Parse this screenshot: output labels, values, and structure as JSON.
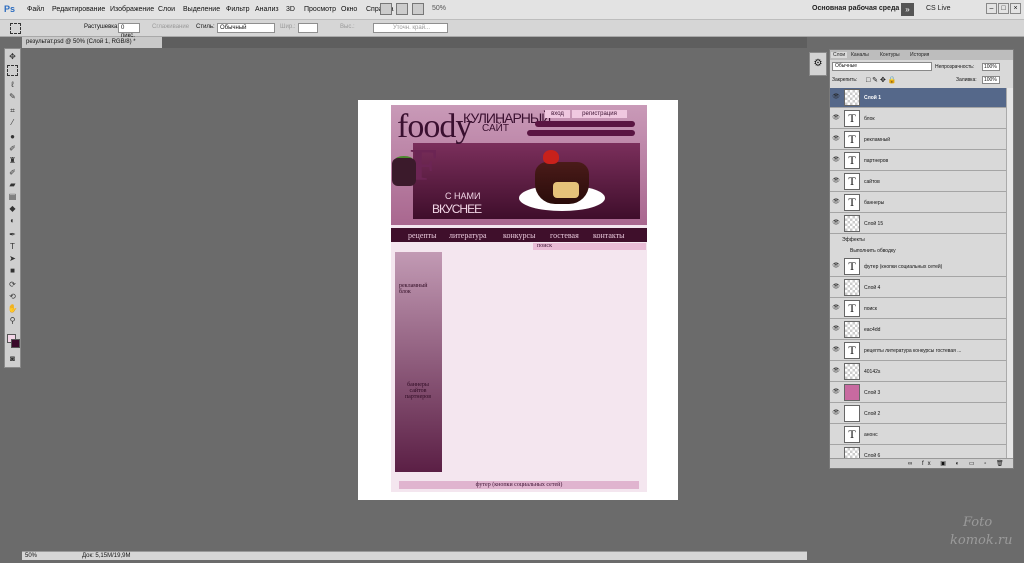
{
  "app": {
    "logo": "Ps"
  },
  "menu": [
    "Файл",
    "Редактирование",
    "Изображение",
    "Слои",
    "Выделение",
    "Фильтр",
    "Анализ",
    "3D",
    "Просмотр",
    "Окно",
    "Справка"
  ],
  "appbar": {
    "zoom": "50%",
    "workspace": "Основная рабочая среда",
    "cslive": "CS Live"
  },
  "options": {
    "feather_label": "Растушевка:",
    "feather_value": "0 пикс.",
    "antialias": "Сглаживание",
    "style_label": "Стиль:",
    "style_value": "Обычный",
    "width_label": "Шир.:",
    "height_label": "Выс.:",
    "refine": "Уточн. край..."
  },
  "document": {
    "tab": "результат.psd @ 50% (Слой 1, RGB/8) *"
  },
  "site": {
    "logo": "foody",
    "kul": "КУЛИНАРНЫЙ",
    "sait": "САЙТ",
    "login": "вход",
    "register": "регистрация",
    "big_letter": "F",
    "slogan1": "С НАМИ",
    "slogan2": "ВКУСНЕЕ",
    "nav": [
      "рецепты",
      "литература",
      "конкурсы",
      "гостевая",
      "контакты"
    ],
    "search": "поиск",
    "adv": "рекламный блок",
    "banners": "баннеры сайтов партнеров",
    "footer": "футер (кнопки социальных сетей)"
  },
  "status": {
    "zoom": "50%",
    "doc": "Док: 5,15M/19,9M"
  },
  "layers_panel": {
    "tabs": [
      "Слои",
      "Каналы",
      "Контуры",
      "История"
    ],
    "blend": "Обычные",
    "opacity_label": "Непрозрачность:",
    "opacity": "100%",
    "lock_label": "Закрепить:",
    "fill_label": "Заливка:",
    "fill": "100%",
    "layers": [
      {
        "name": "Слой 1",
        "type": "img"
      },
      {
        "name": "блок",
        "type": "text"
      },
      {
        "name": "рекламный",
        "type": "text"
      },
      {
        "name": "партнеров",
        "type": "text"
      },
      {
        "name": "сайтов",
        "type": "text"
      },
      {
        "name": "баннеры",
        "type": "text"
      },
      {
        "name": "Слой 15",
        "type": "check"
      }
    ],
    "effects": "Эффекты",
    "stroke": "Выполнить обводку",
    "layers2": [
      {
        "name": "футер (кнопки социальных сетей)",
        "type": "text"
      },
      {
        "name": "Слой 4",
        "type": "check"
      },
      {
        "name": "поиск",
        "type": "text"
      },
      {
        "name": "eac4dd",
        "type": "check"
      },
      {
        "name": "рецепты литература конкурсы гостевая ...",
        "type": "text"
      },
      {
        "name": "40142s",
        "type": "check"
      },
      {
        "name": "Слой 3",
        "type": "pink"
      },
      {
        "name": "Слой 2",
        "type": "white"
      },
      {
        "name": "анонс",
        "type": "text"
      },
      {
        "name": "Слой 6",
        "type": "check"
      }
    ]
  },
  "watermark": {
    "l1": "Foto",
    "l2": "komok.ru"
  }
}
